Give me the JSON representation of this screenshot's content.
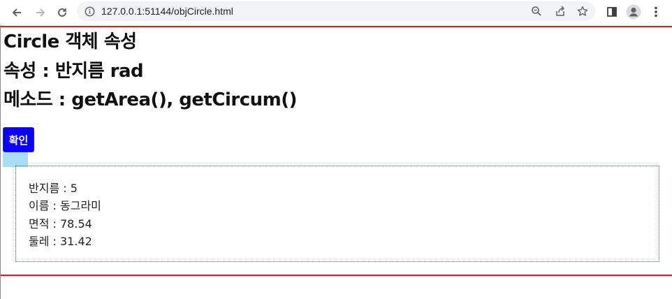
{
  "browser": {
    "url": "127.0.0.1:51144/objCircle.html"
  },
  "page": {
    "headings": [
      "Circle 객체 속성",
      "속성 : 반지름 rad",
      "메소드 : getArea(), getCircum()"
    ],
    "confirm_button": "확인",
    "results": [
      "반지름 : 5",
      "이름 : 동그라미",
      "면적 : 78.54",
      "둘레 : 31.42"
    ]
  },
  "colors": {
    "rule": "#d71e1e",
    "button": "#0a00ff",
    "result_border": "#2e7d32"
  }
}
